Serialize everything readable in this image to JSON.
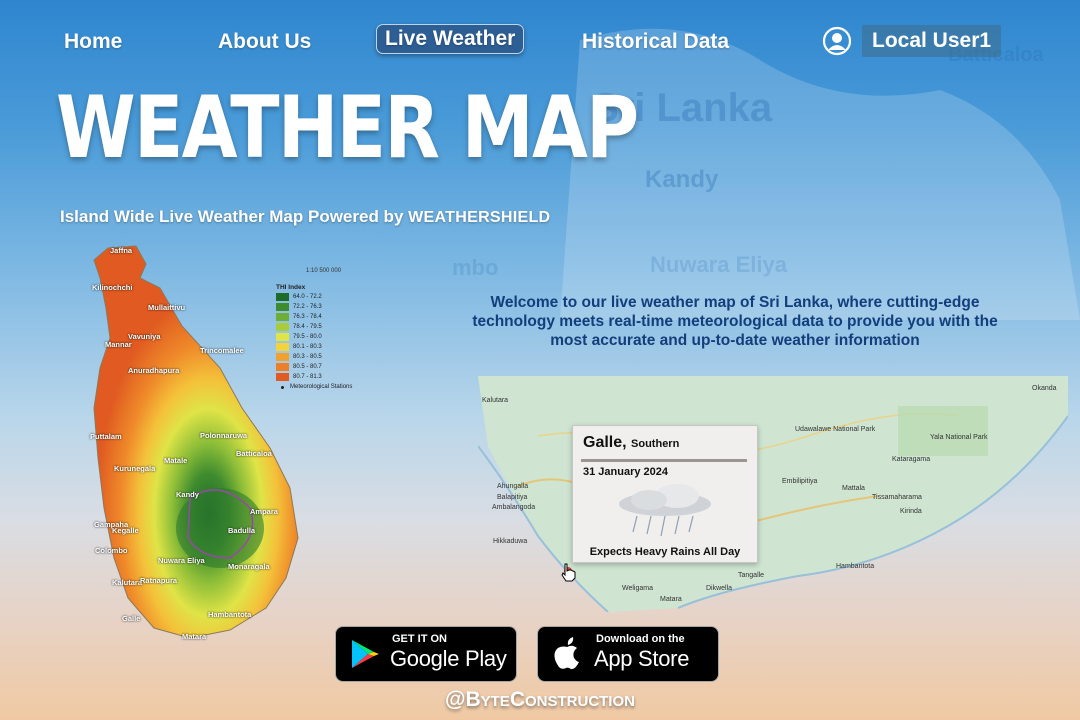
{
  "nav": {
    "home": "Home",
    "about": "About Us",
    "live": "Live Weather",
    "historical": "Historical Data",
    "user": "Local User1"
  },
  "hero": {
    "title": "WEATHER MAP",
    "subtitle": "Island Wide Live Weather Map Powered by",
    "brand": "WEATHERSHIELD"
  },
  "bg_labels": {
    "country": "Sri Lanka",
    "city1": "Kandy",
    "city2": "Nuwara Eliya",
    "city3": "mbo",
    "city4": "Batticaloa"
  },
  "welcome": "Welcome to our live weather map of Sri Lanka, where cutting-edge technology meets real-time meteorological data to provide you with the most accurate and up-to-date weather information",
  "thi_map": {
    "scale": "1:10 500 000",
    "legend_title": "THI Index",
    "legend": [
      {
        "label": "64.0 - 72.2",
        "color": "#1e6b2a"
      },
      {
        "label": "72.2 - 76.3",
        "color": "#3f8c2f"
      },
      {
        "label": "76.3 - 78.4",
        "color": "#6fae34"
      },
      {
        "label": "78.4 - 79.5",
        "color": "#a8cc3a"
      },
      {
        "label": "79.5 - 80.0",
        "color": "#dfe447"
      },
      {
        "label": "80.1 - 80.3",
        "color": "#f4d23b"
      },
      {
        "label": "80.3 - 80.5",
        "color": "#f2a12e"
      },
      {
        "label": "80.5 - 80.7",
        "color": "#ec7f27"
      },
      {
        "label": "80.7 - 81.3",
        "color": "#e05a21"
      }
    ],
    "stations_label": "Meteorological Stations",
    "places": [
      "Jaffna",
      "Kilinochchi",
      "Mullaittivu",
      "Mannar",
      "Vavuniya",
      "Trincomalee",
      "Anuradhapura",
      "Puttalam",
      "Polonnaruwa",
      "Batticaloa",
      "Kurunegala",
      "Matale",
      "Gampaha",
      "Kandy",
      "Ampara",
      "Kegalle",
      "Badulla",
      "Colombo",
      "Nuwara Eliya",
      "Monaragala",
      "Kalutara",
      "Ratnapura",
      "Galle",
      "Hambantota",
      "Matara"
    ]
  },
  "roadmap": {
    "places": [
      "Kalutara",
      "Ahungalla",
      "Balapitiya",
      "Ambalangoda",
      "Hikkaduwa",
      "Weligama",
      "Dikwella",
      "Tangalle",
      "Hambantota",
      "Matara",
      "Mattala",
      "Tissamaharama",
      "Kataragama",
      "Yala National Park",
      "Kirinda",
      "Okanda",
      "Udawalawe National Park",
      "Embilipitiya"
    ]
  },
  "popup": {
    "city": "Galle,",
    "region": "Southern",
    "date": "31 January 2024",
    "message": "Expects Heavy Rains All Day"
  },
  "stores": {
    "google_small": "GET IT ON",
    "google_big": "Google Play",
    "apple_small": "Download on the",
    "apple_big": "App Store"
  },
  "footer": {
    "handle": "@ByteConstruction"
  },
  "colors": {
    "title": "#ffffff",
    "welcome": "#133e7c",
    "nav_active_bg": "#2d5f95"
  }
}
